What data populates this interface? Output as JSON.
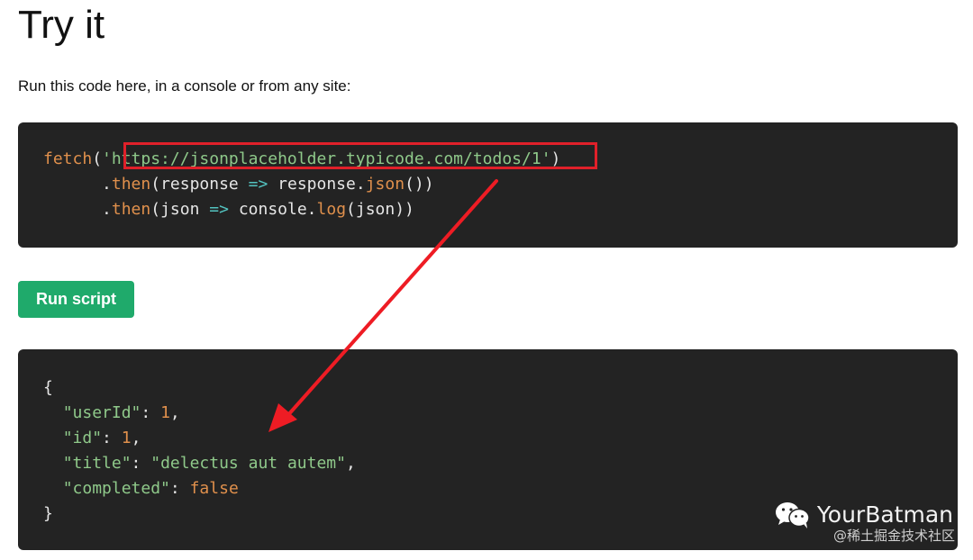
{
  "page": {
    "title": "Try it",
    "intro": "Run this code here, in a console or from any site:"
  },
  "request_code": {
    "line1": {
      "fn": "fetch",
      "open": "(",
      "url": "'https://jsonplaceholder.typicode.com/todos/1'",
      "close": ")"
    },
    "line2": {
      "dot": ".",
      "method": "then",
      "open": "(",
      "param": "response",
      "arrow": "=>",
      "body_obj": "response",
      "body_dot": ".",
      "body_method": "json",
      "close": "())"
    },
    "line3": {
      "dot": ".",
      "method": "then",
      "open": "(",
      "param": "json",
      "arrow": "=>",
      "body_obj": "console",
      "body_dot": ".",
      "body_method": "log",
      "close": "(json))"
    }
  },
  "run_button": {
    "label": "Run script"
  },
  "response_code": {
    "open_brace": "{",
    "fields": [
      {
        "key": "\"userId\"",
        "value": "1",
        "suffix": ","
      },
      {
        "key": "\"id\"",
        "value": "1",
        "suffix": ","
      },
      {
        "key": "\"title\"",
        "value": "\"delectus aut autem\"",
        "suffix": ","
      },
      {
        "key": "\"completed\"",
        "value": "false",
        "suffix": ""
      }
    ],
    "close_brace": "}"
  },
  "watermark": {
    "brand": "YourBatman",
    "subtitle": "@稀土掘金技术社区",
    "icon": "wechat-icon"
  },
  "colors": {
    "accent_button": "#1faa6b",
    "highlight_red": "#e0202a",
    "code_bg": "#232323"
  }
}
